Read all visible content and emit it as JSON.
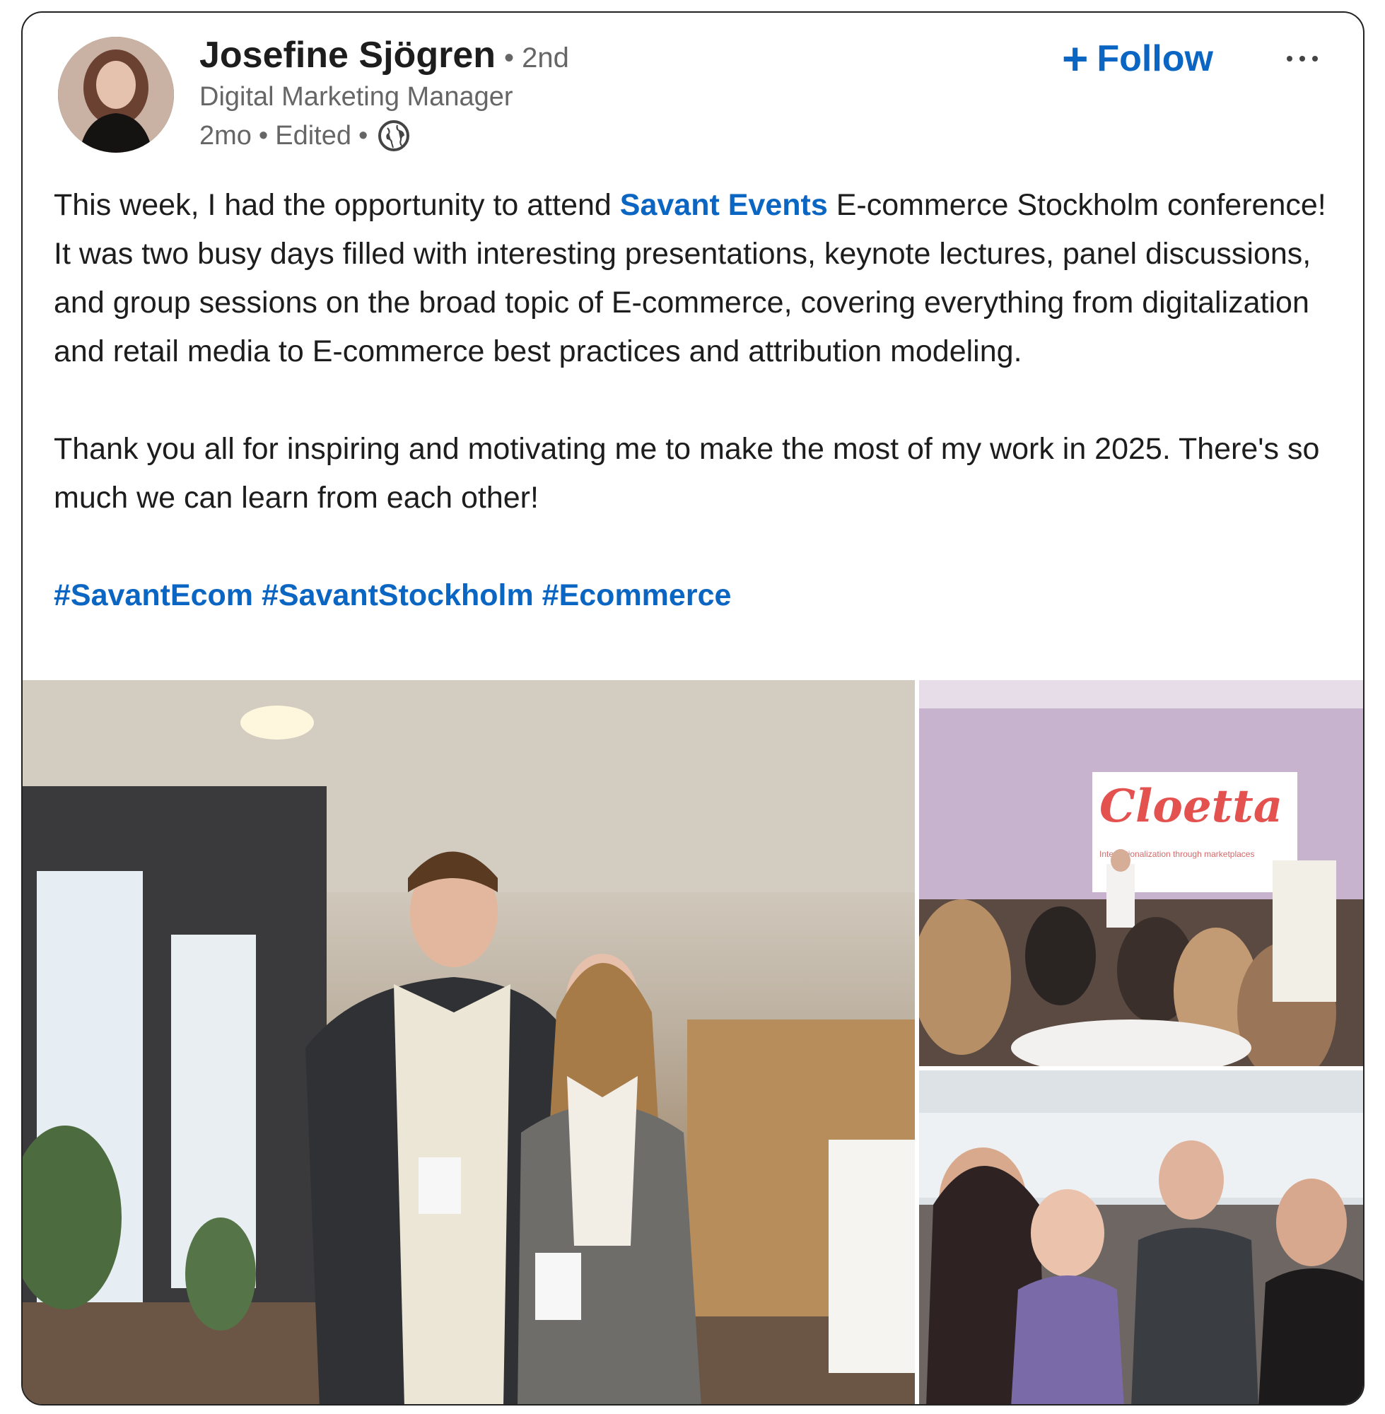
{
  "post": {
    "author": {
      "name": "Josefine Sjögren",
      "degree": "• 2nd",
      "headline": "Digital Marketing Manager",
      "time": "2mo",
      "edited": "Edited",
      "separator": "•",
      "visibility_icon": "globe-icon"
    },
    "actions": {
      "follow_plus": "+",
      "follow_label": "Follow",
      "more_icon": "more-options-icon"
    },
    "body": {
      "p1_before": "This week, I had the opportunity to attend ",
      "mention": "Savant Events",
      "p1_after": " E-commerce Stockholm conference! It was two busy days filled with interesting presentations, keynote lectures, panel discussions, and group sessions on the broad topic of E-commerce, covering everything from digitalization and retail media to E-commerce best practices and attribution modeling.",
      "p2": "Thank you all for inspiring and motivating me to make the most of my work in 2025. There's so much we can learn from each other!",
      "hashtags": [
        "#SavantEcom",
        "#SavantStockholm",
        "#Ecommerce"
      ]
    },
    "images": {
      "slide_logo_text": "Cloetta",
      "slide_subtitle": "Internationalization through marketplaces"
    },
    "colors": {
      "link": "#0a66c2",
      "text": "#1d1d1d",
      "muted": "#666666"
    }
  }
}
